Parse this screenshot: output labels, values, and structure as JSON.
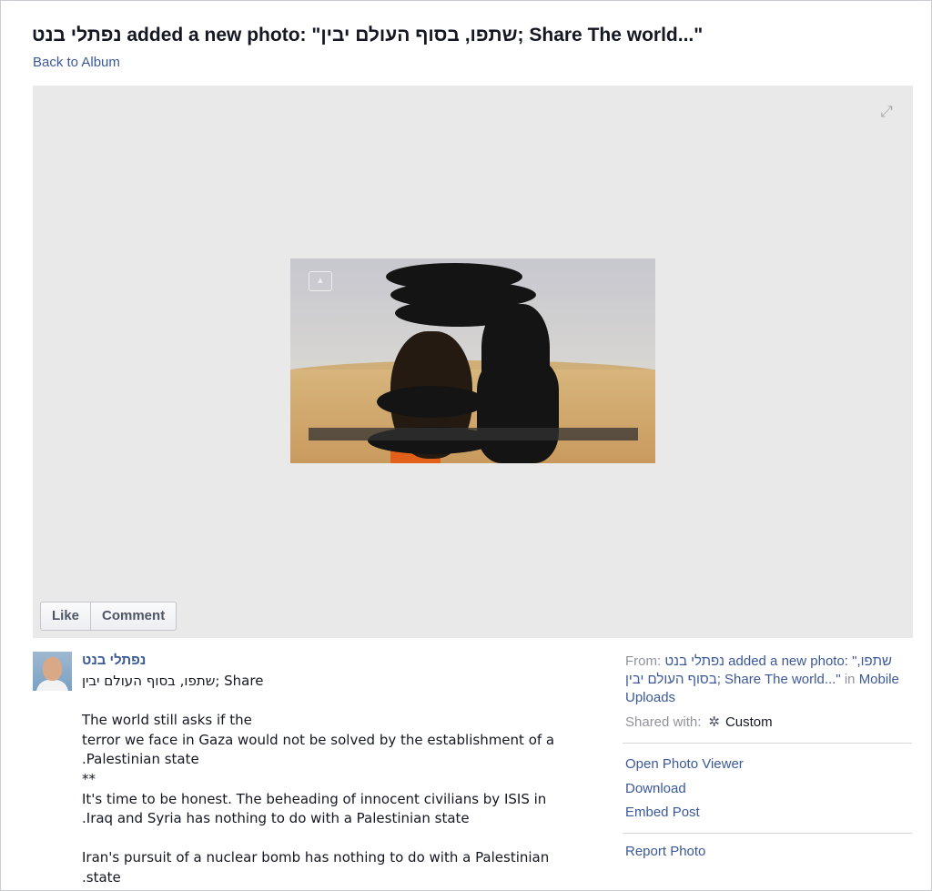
{
  "header": {
    "title": "נפתלי בנט added a new photo: \"שתפו, בסוף העולם יבין; Share The world...\"",
    "back_link": "Back to Album"
  },
  "stage": {
    "expand_icon": "expand-arrows-icon",
    "like_label": "Like",
    "comment_label": "Comment"
  },
  "post": {
    "author": "נפתלי בנט",
    "lines": [
      "שתפו, בסוף העולם יבין; Share",
      "",
      "The world still asks if the",
      "terror we face in Gaza would not be solved by the establishment of a",
      ".Palestinian state",
      "**",
      "It's time to be honest. The beheading of innocent civilians by ISIS in",
      ".Iraq and Syria has nothing to do with a Palestinian state",
      "",
      "Iran's pursuit of a nuclear bomb has nothing to do with a Palestinian",
      ".state"
    ]
  },
  "sidebar": {
    "from_label": "From:",
    "from_link": "נפתלי בנט added a new photo: \"שתפו, בסוף העולם יבין; Share The world...\"",
    "in_label": "in",
    "album_link": "Mobile Uploads",
    "shared_label": "Shared with:",
    "shared_icon": "gear-icon",
    "shared_value": "Custom",
    "actions": [
      "Open Photo Viewer",
      "Download",
      "Embed Post"
    ],
    "report": "Report Photo"
  },
  "colors": {
    "link": "#3b5998",
    "muted": "#8f949c",
    "stage_bg": "#e9e9e9"
  }
}
